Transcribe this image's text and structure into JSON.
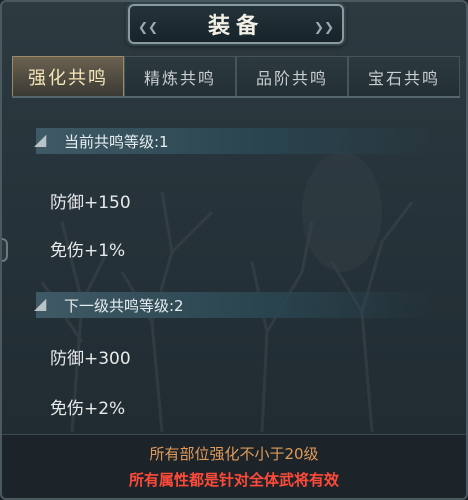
{
  "window": {
    "title": "装备"
  },
  "tabs": [
    {
      "label": "强化共鸣",
      "active": true
    },
    {
      "label": "精炼共鸣",
      "active": false
    },
    {
      "label": "品阶共鸣",
      "active": false
    },
    {
      "label": "宝石共鸣",
      "active": false
    }
  ],
  "current": {
    "header": "当前共鸣等级:1",
    "stats": [
      "防御+150",
      "免伤+1%"
    ]
  },
  "next": {
    "header": "下一级共鸣等级:2",
    "stats": [
      "防御+300",
      "免伤+2%"
    ]
  },
  "footer": {
    "requirement": "所有部位强化不小于20级",
    "note": "所有属性都是针对全体武将有效"
  },
  "colors": {
    "active_tab_text": "#f5e6b8",
    "requirement_text": "#e09a5a",
    "note_text": "#ff4a3a"
  }
}
